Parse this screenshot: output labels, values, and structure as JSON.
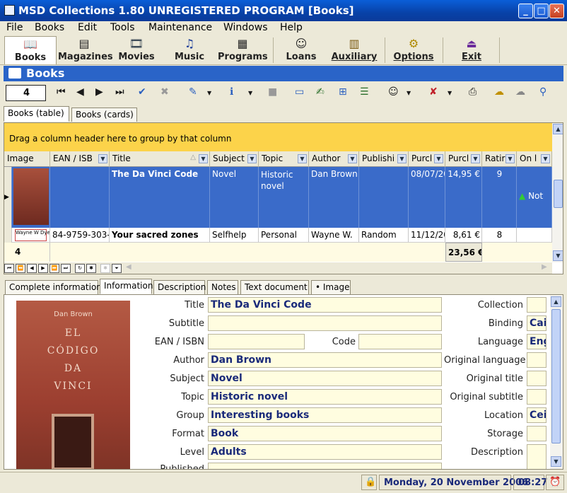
{
  "window": {
    "title": "MSD Collections 1.80 UNREGISTERED PROGRAM [Books]"
  },
  "menu": [
    "File",
    "Books",
    "Edit",
    "Tools",
    "Maintenance",
    "Windows",
    "Help"
  ],
  "main_toolbar": [
    {
      "label": "Books",
      "icon": "book-icon"
    },
    {
      "label": "Magazines",
      "icon": "magazine-icon"
    },
    {
      "label": "Movies",
      "icon": "film-icon"
    },
    {
      "label": "Music",
      "icon": "music-note-icon"
    },
    {
      "label": "Programs",
      "icon": "programs-icon"
    },
    {
      "label": "Loans",
      "icon": "person-icon"
    },
    {
      "label": "Auxiliary",
      "icon": "auxiliary-icon"
    },
    {
      "label": "Options",
      "icon": "gears-icon"
    },
    {
      "label": "Exit",
      "icon": "exit-door-icon"
    }
  ],
  "section": {
    "title": "Books"
  },
  "record_toolbar": {
    "record_number": "4"
  },
  "view_tabs": [
    "Books (table)",
    "Books (cards)"
  ],
  "grid": {
    "group_hint": "Drag a column header here to group by that column",
    "columns": [
      "Image",
      "EAN / ISB",
      "Title",
      "Subject",
      "Topic",
      "Author",
      "Publishi",
      "Purcl",
      "Purcl",
      "Ratir",
      "On l"
    ],
    "rows": [
      {
        "ean": "",
        "title": "The Da Vinci Code",
        "subject": "Novel",
        "topic": "Historic novel",
        "author": "Dan Brown",
        "publisher": "",
        "date": "08/07/20",
        "price": "14,95 €",
        "rating": "9",
        "loan": "Not"
      },
      {
        "ean": "84-9759-303-0",
        "title": "Your sacred zones",
        "subject": "Selfhelp",
        "topic": "Personal",
        "author": "Wayne W.",
        "publisher": "Random",
        "date": "11/12/20",
        "price": "8,61 €",
        "rating": "8",
        "loan": ""
      }
    ],
    "footer": {
      "count": "4",
      "total": "23,56 €"
    },
    "thumb_caption": "Wayne W Dyer"
  },
  "detail_tabs": [
    "Complete information",
    "Information",
    "Description",
    "Notes",
    "Text document",
    "• Image"
  ],
  "cover": {
    "author": "Dan Brown",
    "title_lines": [
      "EL",
      "CÓDIGO",
      "DA",
      "VINCI"
    ]
  },
  "detail": {
    "title_label": "Title",
    "title": "The Da Vinci Code",
    "subtitle_label": "Subtitle",
    "subtitle": "",
    "ean_label": "EAN / ISBN",
    "ean": "",
    "code_label": "Code",
    "code": "",
    "author_label": "Author",
    "author": "Dan Brown",
    "subject_label": "Subject",
    "subject": "Novel",
    "topic_label": "Topic",
    "topic": "Historic novel",
    "group_label": "Group",
    "group": "Interesting books",
    "format_label": "Format",
    "format": "Book",
    "level_label": "Level",
    "level": "Adults",
    "published_label": "Published",
    "collection_label": "Collection",
    "collection": "",
    "binding_label": "Binding",
    "binding": "Cai",
    "language_label": "Language",
    "language": "Eng",
    "orig_lang_label": "Original language",
    "orig_lang": "",
    "orig_title_label": "Original title",
    "orig_title": "",
    "orig_subtitle_label": "Original subtitle",
    "orig_subtitle": "",
    "location_label": "Location",
    "location": "Cei",
    "storage_label": "Storage",
    "storage": "",
    "description_label": "Description"
  },
  "status": {
    "date": "Monday, 20 November 2006",
    "time": "08:27"
  },
  "colors": {
    "titlebar": "#0a5fd8",
    "section": "#2a64c8",
    "selected_row": "#3a6bc9",
    "group_band": "#fcd34a",
    "field_bg": "#fffde0"
  }
}
